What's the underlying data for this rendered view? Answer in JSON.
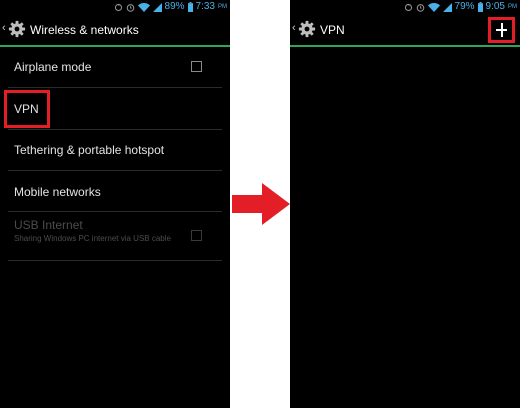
{
  "left_screen": {
    "status": {
      "battery": "89%",
      "time": "7:33",
      "ampm": "PM"
    },
    "title": "Wireless & networks",
    "items": [
      {
        "label": "Airplane mode"
      },
      {
        "label": "VPN"
      },
      {
        "label": "Tethering & portable hotspot"
      },
      {
        "label": "Mobile networks"
      },
      {
        "label": "USB Internet",
        "sub": "Sharing Windows PC internet via USB cable"
      }
    ]
  },
  "right_screen": {
    "status": {
      "battery": "79%",
      "time": "9:05",
      "ampm": "PM"
    },
    "title": "VPN",
    "add_icon": "plus-icon"
  },
  "colors": {
    "accent_green": "#2fa55a",
    "status_blue": "#4ab0e8",
    "highlight_red": "#e41e26"
  }
}
